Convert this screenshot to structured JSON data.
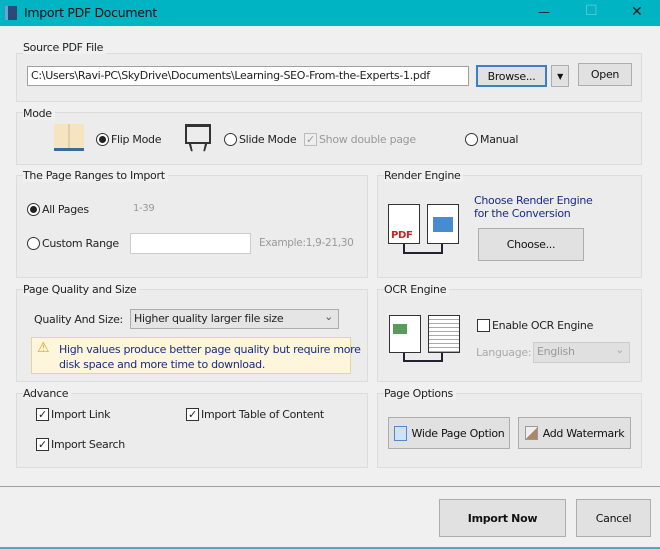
{
  "window": {
    "title": "Import PDF Document",
    "accent": "#00b4c4"
  },
  "source": {
    "label": "Source PDF File",
    "path": "C:\\Users\\Ravi-PC\\SkyDrive\\Documents\\Learning-SEO-From-the-Experts-1.pdf",
    "browse": "Browse...",
    "open": "Open"
  },
  "mode": {
    "label": "Mode",
    "flip": "Flip Mode",
    "slide": "Slide Mode",
    "double": "Show double page",
    "manual": "Manual",
    "selected": "Flip Mode"
  },
  "ranges": {
    "label": "The Page Ranges to Import",
    "all": "All Pages",
    "all_value": "1-39",
    "custom": "Custom Range",
    "custom_value": "",
    "example": "Example:1,9-21,30"
  },
  "render": {
    "label": "Render Engine",
    "desc1": "Choose Render Engine",
    "desc2": "for the Conversion",
    "choose": "Choose..."
  },
  "quality": {
    "label": "Page Quality and Size",
    "field_label": "Quality And Size:",
    "value": "Higher quality larger file size",
    "warn1": "High values produce better page quality but require more",
    "warn2": "disk space and more time to download."
  },
  "ocr": {
    "label": "OCR Engine",
    "enable": "Enable OCR Engine",
    "enabled": false,
    "language_label": "Language:",
    "language": "English"
  },
  "advance": {
    "label": "Advance",
    "link": "Import Link",
    "toc": "Import Table of Content",
    "search": "Import Search"
  },
  "page_options": {
    "label": "Page Options",
    "wide": "Wide Page Option",
    "watermark": "Add Watermark"
  },
  "footer": {
    "import": "Import Now",
    "cancel": "Cancel"
  },
  "icons": {
    "min": "—",
    "max": "☐",
    "close": "✕",
    "dropdown": "▼",
    "chevron": "⌄",
    "check": "✓",
    "warn": "⚠"
  }
}
